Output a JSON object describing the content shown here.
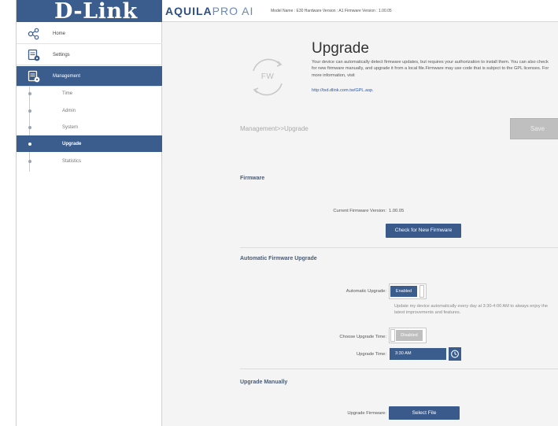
{
  "header": {
    "logo": "D-Link",
    "brand_part1": "AQUILA",
    "brand_part2": "PRO AI",
    "model_info": "Model Name : E30 Hardware Version : A1 Firmware Version : 1.00.05"
  },
  "sidebar": {
    "items": [
      {
        "label": "Home",
        "icon": "home-network-icon"
      },
      {
        "label": "Settings",
        "icon": "settings-icon"
      },
      {
        "label": "Management",
        "icon": "management-icon"
      }
    ],
    "subitems": [
      {
        "label": "Time"
      },
      {
        "label": "Admin"
      },
      {
        "label": "System"
      },
      {
        "label": "Upgrade"
      },
      {
        "label": "Statistics"
      }
    ]
  },
  "page": {
    "icon_text": "FW",
    "title": "Upgrade",
    "description": "Your device can automatically detect firmware updates, but requires your authorization to install them. You can also check for new firmware manually, and upgrade it from a local file.Firmware may use code that is subject to the GPL licenses. For more information, visit",
    "link": "http://tsd.dlink.com.tw/GPL.asp.",
    "breadcrumb": "Management>>Upgrade",
    "save_label": "Save"
  },
  "firmware": {
    "section_title": "Firmware",
    "current_version_label": "Current Firmware Version:",
    "current_version_value": "1.00.05",
    "check_button": "Check for New Firmware"
  },
  "auto_upgrade": {
    "section_title": "Automatic Firmware Upgrade",
    "auto_label": "Automatic Upgrade:",
    "auto_state": "Enabled",
    "note": "Update my device automatically every day at 3:30-4:00 AM to always enjoy the latest improvements and features.",
    "choose_time_label": "Choose Upgrade Time:",
    "choose_time_state": "Disabled",
    "time_label": "Upgrade Time:",
    "time_value": "3:30 AM"
  },
  "manual": {
    "section_title": "Upgrade Manually",
    "firmware_label": "Upgrade Firmware:",
    "select_button": "Select File"
  },
  "colors": {
    "accent": "#3b5d8e",
    "disabled": "#bfbfbf"
  }
}
